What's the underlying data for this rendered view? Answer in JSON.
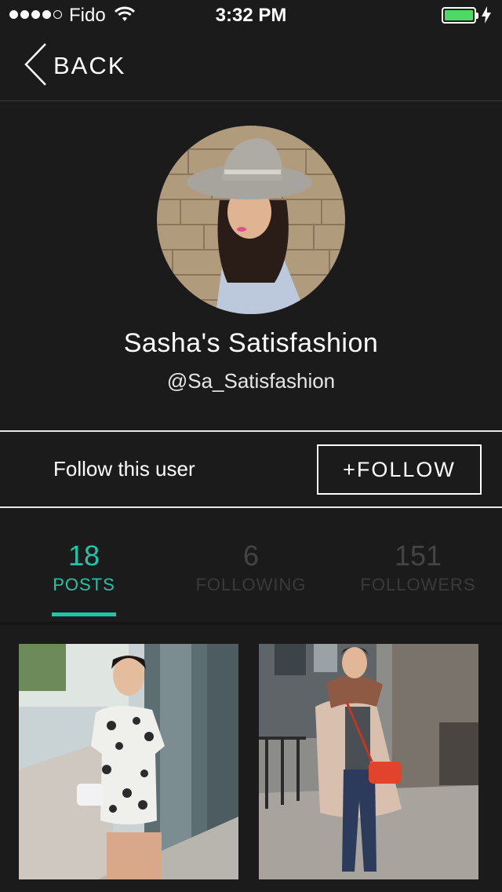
{
  "status_bar": {
    "carrier": "Fido",
    "time": "3:32 PM",
    "signal_bars": 4,
    "signal_max": 5,
    "battery_level": 1.0,
    "icons": [
      "wifi-icon",
      "battery-icon",
      "charging-bolt-icon"
    ]
  },
  "nav": {
    "back_label": "BACK",
    "back_icon": "chevron-left-icon"
  },
  "profile": {
    "name": "Sasha's Satisfashion",
    "handle": "@Sa_Satisfashion"
  },
  "follow": {
    "prompt": "Follow this user",
    "button_label": "+FOLLOW"
  },
  "stats": [
    {
      "value": "18",
      "label": "POSTS",
      "active": true
    },
    {
      "value": "6",
      "label": "FOLLOWING",
      "active": false
    },
    {
      "value": "151",
      "label": "FOLLOWERS",
      "active": false
    }
  ],
  "colors": {
    "accent": "#1fc5a8",
    "background": "#1b1b1b",
    "inactive_stat": "#444444"
  }
}
